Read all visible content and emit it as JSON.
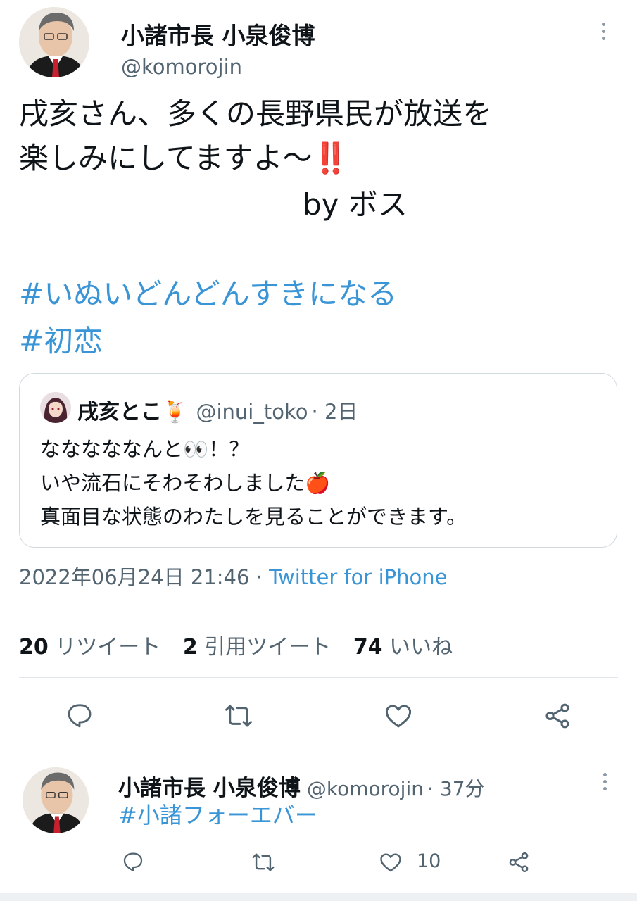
{
  "main_tweet": {
    "author_name": "小諸市長 小泉俊博",
    "author_handle": "@komorojin",
    "text_line1": "戌亥さん、多くの長野県民が放送を",
    "text_line2": "楽しみにしてますよ〜‼️",
    "text_line3": "by ボス",
    "hashtag1": "#いぬいどんどんすきになる",
    "hashtag2": "#初恋",
    "quote": {
      "author_name": "戌亥とこ🍹",
      "author_handle": "@inui_toko",
      "time": "· 2日",
      "line1": "なななななんと👀！？",
      "line2": "いや流石にそわそわしました🍎",
      "line3": "真面目な状態のわたしを見ることができます。"
    },
    "timestamp": "2022年06月24日 21:46 ·",
    "source": "Twitter for iPhone",
    "stats": {
      "retweets_count": "20",
      "retweets_label": "リツイート",
      "quotes_count": "2",
      "quotes_label": "引用ツイート",
      "likes_count": "74",
      "likes_label": "いいね"
    }
  },
  "reply_tweet": {
    "author_name": "小諸市長 小泉俊博",
    "author_handle": "@komorojin",
    "time": "· 37分",
    "hashtag": "#小諸フォーエバー",
    "like_count": "10"
  },
  "icons": [
    "more-icon",
    "reply-icon",
    "retweet-icon",
    "like-icon",
    "share-icon"
  ],
  "colors": {
    "link": "#3a95d6",
    "secondary": "#536471",
    "divider": "#e1e8ed"
  }
}
